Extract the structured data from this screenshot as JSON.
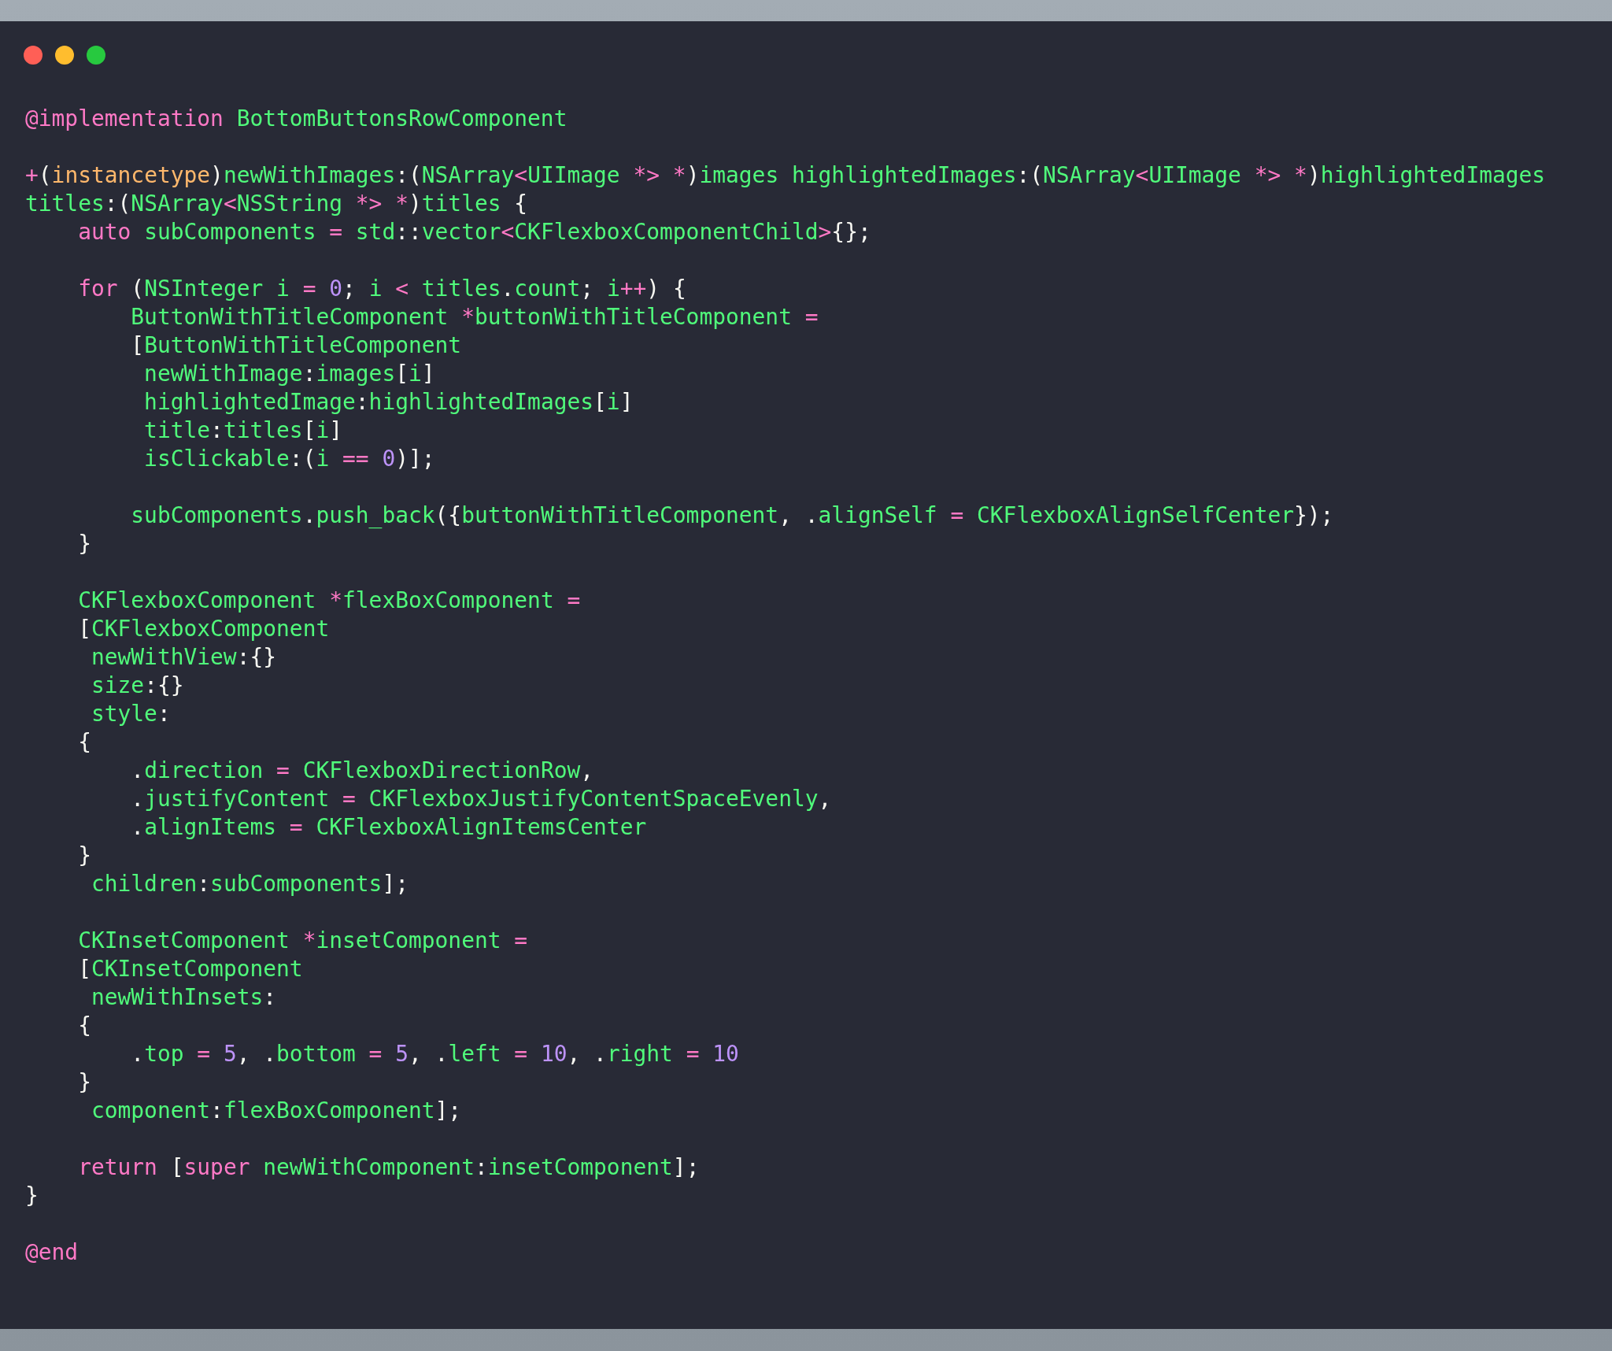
{
  "window": {
    "controls": [
      {
        "kind": "close"
      },
      {
        "kind": "minimize"
      },
      {
        "kind": "zoom"
      }
    ]
  },
  "code": [
    {
      "kind": "code",
      "tokens": [
        {
          "kind": "keyword",
          "text": "@implementation"
        },
        {
          "kind": "name",
          "text": " BottomButtonsRowComponent"
        }
      ]
    },
    {
      "kind": "blank"
    },
    {
      "kind": "code",
      "tokens": [
        {
          "kind": "keyword",
          "text": "+"
        },
        {
          "kind": "punct",
          "text": "("
        },
        {
          "kind": "type",
          "text": "instancetype"
        },
        {
          "kind": "punct",
          "text": ")"
        },
        {
          "kind": "name",
          "text": "newWithImages"
        },
        {
          "kind": "punct",
          "text": ":("
        },
        {
          "kind": "name",
          "text": "NSArray"
        },
        {
          "kind": "keyword",
          "text": "<"
        },
        {
          "kind": "name",
          "text": "UIImage "
        },
        {
          "kind": "keyword",
          "text": "*> *"
        },
        {
          "kind": "punct",
          "text": ")"
        },
        {
          "kind": "name",
          "text": "images highlightedImages"
        },
        {
          "kind": "punct",
          "text": ":("
        },
        {
          "kind": "name",
          "text": "NSArray"
        },
        {
          "kind": "keyword",
          "text": "<"
        },
        {
          "kind": "name",
          "text": "UIImage "
        },
        {
          "kind": "keyword",
          "text": "*> *"
        },
        {
          "kind": "punct",
          "text": ")"
        },
        {
          "kind": "name",
          "text": "highlightedImages"
        }
      ]
    },
    {
      "kind": "code",
      "tokens": [
        {
          "kind": "name",
          "text": "titles"
        },
        {
          "kind": "punct",
          "text": ":("
        },
        {
          "kind": "name",
          "text": "NSArray"
        },
        {
          "kind": "keyword",
          "text": "<"
        },
        {
          "kind": "name",
          "text": "NSString "
        },
        {
          "kind": "keyword",
          "text": "*> *"
        },
        {
          "kind": "punct",
          "text": ")"
        },
        {
          "kind": "name",
          "text": "titles "
        },
        {
          "kind": "punct",
          "text": "{"
        }
      ]
    },
    {
      "kind": "code",
      "tokens": [
        {
          "kind": "keyword",
          "text": "    auto"
        },
        {
          "kind": "name",
          "text": " subComponents "
        },
        {
          "kind": "keyword",
          "text": "="
        },
        {
          "kind": "name",
          "text": " std"
        },
        {
          "kind": "punct",
          "text": "::"
        },
        {
          "kind": "name",
          "text": "vector"
        },
        {
          "kind": "keyword",
          "text": "<"
        },
        {
          "kind": "name",
          "text": "CKFlexboxComponentChild"
        },
        {
          "kind": "keyword",
          "text": ">"
        },
        {
          "kind": "punct",
          "text": "{};"
        }
      ]
    },
    {
      "kind": "blank"
    },
    {
      "kind": "code",
      "tokens": [
        {
          "kind": "keyword",
          "text": "    for"
        },
        {
          "kind": "punct",
          "text": " ("
        },
        {
          "kind": "name",
          "text": "NSInteger i "
        },
        {
          "kind": "keyword",
          "text": "= "
        },
        {
          "kind": "number",
          "text": "0"
        },
        {
          "kind": "punct",
          "text": "; "
        },
        {
          "kind": "name",
          "text": "i "
        },
        {
          "kind": "keyword",
          "text": "<"
        },
        {
          "kind": "name",
          "text": " titles"
        },
        {
          "kind": "punct",
          "text": "."
        },
        {
          "kind": "name",
          "text": "count"
        },
        {
          "kind": "punct",
          "text": "; "
        },
        {
          "kind": "name",
          "text": "i"
        },
        {
          "kind": "keyword",
          "text": "++"
        },
        {
          "kind": "punct",
          "text": ") {"
        }
      ]
    },
    {
      "kind": "code",
      "tokens": [
        {
          "kind": "name",
          "text": "        ButtonWithTitleComponent "
        },
        {
          "kind": "keyword",
          "text": "*"
        },
        {
          "kind": "name",
          "text": "buttonWithTitleComponent "
        },
        {
          "kind": "keyword",
          "text": "="
        }
      ]
    },
    {
      "kind": "code",
      "tokens": [
        {
          "kind": "punct",
          "text": "        ["
        },
        {
          "kind": "name",
          "text": "ButtonWithTitleComponent"
        }
      ]
    },
    {
      "kind": "code",
      "tokens": [
        {
          "kind": "name",
          "text": "         newWithImage"
        },
        {
          "kind": "punct",
          "text": ":"
        },
        {
          "kind": "name",
          "text": "images"
        },
        {
          "kind": "punct",
          "text": "["
        },
        {
          "kind": "name",
          "text": "i"
        },
        {
          "kind": "punct",
          "text": "]"
        }
      ]
    },
    {
      "kind": "code",
      "tokens": [
        {
          "kind": "name",
          "text": "         highlightedImage"
        },
        {
          "kind": "punct",
          "text": ":"
        },
        {
          "kind": "name",
          "text": "highlightedImages"
        },
        {
          "kind": "punct",
          "text": "["
        },
        {
          "kind": "name",
          "text": "i"
        },
        {
          "kind": "punct",
          "text": "]"
        }
      ]
    },
    {
      "kind": "code",
      "tokens": [
        {
          "kind": "name",
          "text": "         title"
        },
        {
          "kind": "punct",
          "text": ":"
        },
        {
          "kind": "name",
          "text": "titles"
        },
        {
          "kind": "punct",
          "text": "["
        },
        {
          "kind": "name",
          "text": "i"
        },
        {
          "kind": "punct",
          "text": "]"
        }
      ]
    },
    {
      "kind": "code",
      "tokens": [
        {
          "kind": "name",
          "text": "         isClickable"
        },
        {
          "kind": "punct",
          "text": ":("
        },
        {
          "kind": "name",
          "text": "i "
        },
        {
          "kind": "keyword",
          "text": "== "
        },
        {
          "kind": "number",
          "text": "0"
        },
        {
          "kind": "punct",
          "text": ")];"
        }
      ]
    },
    {
      "kind": "blank"
    },
    {
      "kind": "code",
      "tokens": [
        {
          "kind": "name",
          "text": "        subComponents"
        },
        {
          "kind": "punct",
          "text": "."
        },
        {
          "kind": "name",
          "text": "push_back"
        },
        {
          "kind": "punct",
          "text": "({"
        },
        {
          "kind": "name",
          "text": "buttonWithTitleComponent"
        },
        {
          "kind": "punct",
          "text": ", ."
        },
        {
          "kind": "name",
          "text": "alignSelf "
        },
        {
          "kind": "keyword",
          "text": "="
        },
        {
          "kind": "name",
          "text": " CKFlexboxAlignSelfCenter"
        },
        {
          "kind": "punct",
          "text": "});"
        }
      ]
    },
    {
      "kind": "code",
      "tokens": [
        {
          "kind": "punct",
          "text": "    }"
        }
      ]
    },
    {
      "kind": "blank"
    },
    {
      "kind": "code",
      "tokens": [
        {
          "kind": "name",
          "text": "    CKFlexboxComponent "
        },
        {
          "kind": "keyword",
          "text": "*"
        },
        {
          "kind": "name",
          "text": "flexBoxComponent "
        },
        {
          "kind": "keyword",
          "text": "="
        }
      ]
    },
    {
      "kind": "code",
      "tokens": [
        {
          "kind": "punct",
          "text": "    ["
        },
        {
          "kind": "name",
          "text": "CKFlexboxComponent"
        }
      ]
    },
    {
      "kind": "code",
      "tokens": [
        {
          "kind": "name",
          "text": "     newWithView"
        },
        {
          "kind": "punct",
          "text": ":{}"
        }
      ]
    },
    {
      "kind": "code",
      "tokens": [
        {
          "kind": "name",
          "text": "     size"
        },
        {
          "kind": "punct",
          "text": ":{}"
        }
      ]
    },
    {
      "kind": "code",
      "tokens": [
        {
          "kind": "name",
          "text": "     style"
        },
        {
          "kind": "punct",
          "text": ":"
        }
      ]
    },
    {
      "kind": "code",
      "tokens": [
        {
          "kind": "punct",
          "text": "    {"
        }
      ]
    },
    {
      "kind": "code",
      "tokens": [
        {
          "kind": "punct",
          "text": "        ."
        },
        {
          "kind": "name",
          "text": "direction "
        },
        {
          "kind": "keyword",
          "text": "="
        },
        {
          "kind": "name",
          "text": " CKFlexboxDirectionRow"
        },
        {
          "kind": "punct",
          "text": ","
        }
      ]
    },
    {
      "kind": "code",
      "tokens": [
        {
          "kind": "punct",
          "text": "        ."
        },
        {
          "kind": "name",
          "text": "justifyContent "
        },
        {
          "kind": "keyword",
          "text": "="
        },
        {
          "kind": "name",
          "text": " CKFlexboxJustifyContentSpaceEvenly"
        },
        {
          "kind": "punct",
          "text": ","
        }
      ]
    },
    {
      "kind": "code",
      "tokens": [
        {
          "kind": "punct",
          "text": "        ."
        },
        {
          "kind": "name",
          "text": "alignItems "
        },
        {
          "kind": "keyword",
          "text": "="
        },
        {
          "kind": "name",
          "text": " CKFlexboxAlignItemsCenter"
        }
      ]
    },
    {
      "kind": "code",
      "tokens": [
        {
          "kind": "punct",
          "text": "    }"
        }
      ]
    },
    {
      "kind": "code",
      "tokens": [
        {
          "kind": "name",
          "text": "     children"
        },
        {
          "kind": "punct",
          "text": ":"
        },
        {
          "kind": "name",
          "text": "subComponents"
        },
        {
          "kind": "punct",
          "text": "];"
        }
      ]
    },
    {
      "kind": "blank"
    },
    {
      "kind": "code",
      "tokens": [
        {
          "kind": "name",
          "text": "    CKInsetComponent "
        },
        {
          "kind": "keyword",
          "text": "*"
        },
        {
          "kind": "name",
          "text": "insetComponent "
        },
        {
          "kind": "keyword",
          "text": "="
        }
      ]
    },
    {
      "kind": "code",
      "tokens": [
        {
          "kind": "punct",
          "text": "    ["
        },
        {
          "kind": "name",
          "text": "CKInsetComponent"
        }
      ]
    },
    {
      "kind": "code",
      "tokens": [
        {
          "kind": "name",
          "text": "     newWithInsets"
        },
        {
          "kind": "punct",
          "text": ":"
        }
      ]
    },
    {
      "kind": "code",
      "tokens": [
        {
          "kind": "punct",
          "text": "    {"
        }
      ]
    },
    {
      "kind": "code",
      "tokens": [
        {
          "kind": "punct",
          "text": "        ."
        },
        {
          "kind": "name",
          "text": "top "
        },
        {
          "kind": "keyword",
          "text": "= "
        },
        {
          "kind": "number",
          "text": "5"
        },
        {
          "kind": "punct",
          "text": ", ."
        },
        {
          "kind": "name",
          "text": "bottom "
        },
        {
          "kind": "keyword",
          "text": "= "
        },
        {
          "kind": "number",
          "text": "5"
        },
        {
          "kind": "punct",
          "text": ", ."
        },
        {
          "kind": "name",
          "text": "left "
        },
        {
          "kind": "keyword",
          "text": "= "
        },
        {
          "kind": "number",
          "text": "10"
        },
        {
          "kind": "punct",
          "text": ", ."
        },
        {
          "kind": "name",
          "text": "right "
        },
        {
          "kind": "keyword",
          "text": "= "
        },
        {
          "kind": "number",
          "text": "10"
        }
      ]
    },
    {
      "kind": "code",
      "tokens": [
        {
          "kind": "punct",
          "text": "    }"
        }
      ]
    },
    {
      "kind": "code",
      "tokens": [
        {
          "kind": "name",
          "text": "     component"
        },
        {
          "kind": "punct",
          "text": ":"
        },
        {
          "kind": "name",
          "text": "flexBoxComponent"
        },
        {
          "kind": "punct",
          "text": "];"
        }
      ]
    },
    {
      "kind": "blank"
    },
    {
      "kind": "code",
      "tokens": [
        {
          "kind": "keyword",
          "text": "    return"
        },
        {
          "kind": "punct",
          "text": " ["
        },
        {
          "kind": "keyword",
          "text": "super"
        },
        {
          "kind": "name",
          "text": " newWithComponent"
        },
        {
          "kind": "punct",
          "text": ":"
        },
        {
          "kind": "name",
          "text": "insetComponent"
        },
        {
          "kind": "punct",
          "text": "];"
        }
      ]
    },
    {
      "kind": "code",
      "tokens": [
        {
          "kind": "punct",
          "text": "}"
        }
      ]
    },
    {
      "kind": "blank"
    },
    {
      "kind": "code",
      "tokens": [
        {
          "kind": "keyword",
          "text": "@end"
        }
      ]
    }
  ]
}
